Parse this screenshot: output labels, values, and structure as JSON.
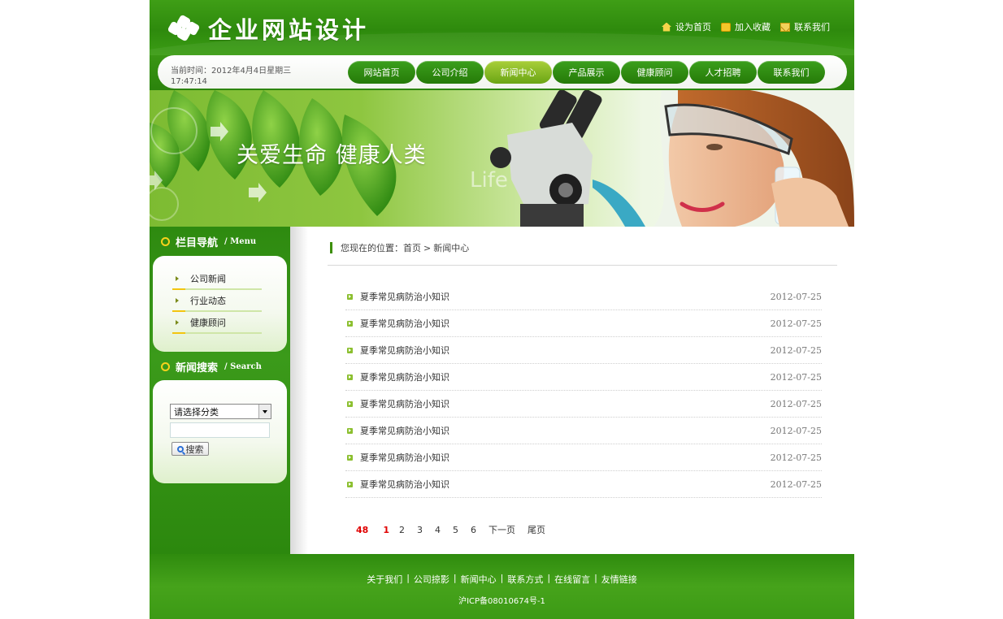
{
  "header": {
    "logo_text": "企业网站设计",
    "toplinks": [
      {
        "label": "设为首页",
        "icon": "home-icon"
      },
      {
        "label": "加入收藏",
        "icon": "favorite-icon"
      },
      {
        "label": "联系我们",
        "icon": "mail-icon"
      }
    ]
  },
  "nav": {
    "datetime": "当前时间：2012年4月4日星期三 17:47:14",
    "items": [
      "网站首页",
      "公司介绍",
      "新闻中心",
      "产品展示",
      "健康顾问",
      "人才招聘",
      "联系我们"
    ],
    "active": "新闻中心"
  },
  "banner": {
    "slogan": "关爱生命 健康人类",
    "watermark": "Life"
  },
  "sidebar": {
    "menu_title": "栏目导航",
    "menu_title_en": "/ Menu",
    "categories": [
      "公司新闻",
      "行业动态",
      "健康顾问"
    ],
    "search_title": "新闻搜索",
    "search_title_en": "/ Search",
    "select_value": "请选择分类",
    "search_value": "",
    "search_button": "搜索"
  },
  "main": {
    "crumb_prefix": "您现在的位置：",
    "crumb_home": "首页",
    "crumb_sep": ">",
    "crumb_current": "新闻中心",
    "news": [
      {
        "title": "夏季常见病防治小知识",
        "date": "2012-07-25"
      },
      {
        "title": "夏季常见病防治小知识",
        "date": "2012-07-25"
      },
      {
        "title": "夏季常见病防治小知识",
        "date": "2012-07-25"
      },
      {
        "title": "夏季常见病防治小知识",
        "date": "2012-07-25"
      },
      {
        "title": "夏季常见病防治小知识",
        "date": "2012-07-25"
      },
      {
        "title": "夏季常见病防治小知识",
        "date": "2012-07-25"
      },
      {
        "title": "夏季常见病防治小知识",
        "date": "2012-07-25"
      },
      {
        "title": "夏季常见病防治小知识",
        "date": "2012-07-25"
      }
    ],
    "pager": {
      "total": "48",
      "current": "1",
      "pages": [
        "2",
        "3",
        "4",
        "5",
        "6"
      ],
      "next": "下一页",
      "last": "尾页"
    }
  },
  "footer": {
    "links": [
      "关于我们",
      "公司掠影",
      "新闻中心",
      "联系方式",
      "在线留言",
      "友情链接"
    ],
    "separator": "|",
    "icp": "沪ICP备08010674号-1"
  },
  "colors": {
    "primary_green": "#2e8a0d",
    "active_nav": "#a9cf3a",
    "accent_yellow": "#f7d21c",
    "pager_red": "#e00000"
  }
}
